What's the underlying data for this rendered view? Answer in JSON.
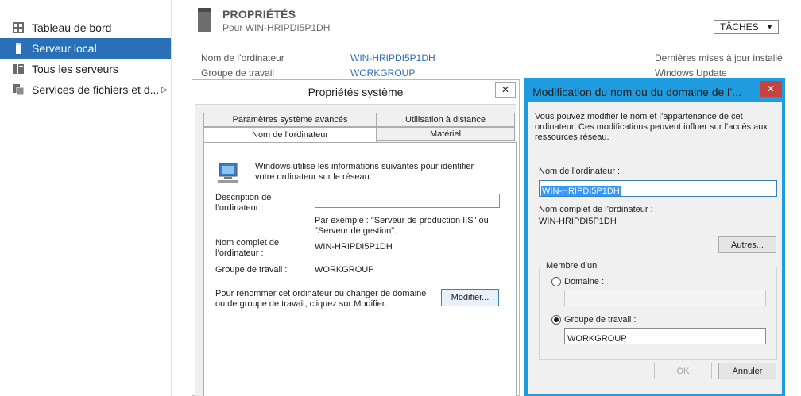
{
  "sidebar": {
    "items": [
      {
        "label": "Tableau de bord",
        "icon": "dashboard-icon",
        "active": false
      },
      {
        "label": "Serveur local",
        "icon": "server-icon",
        "active": true
      },
      {
        "label": "Tous les serveurs",
        "icon": "servers-icon",
        "active": false
      },
      {
        "label": "Services de fichiers et d...",
        "icon": "file-services-icon",
        "active": false
      }
    ]
  },
  "header": {
    "title": "PROPRIÉTÉS",
    "subtitle": "Pour WIN-HRIPDI5P1DH",
    "tasks_label": "TÂCHES"
  },
  "properties": {
    "computer_name_label": "Nom de l’ordinateur",
    "computer_name_value": "WIN-HRIPDI5P1DH",
    "workgroup_label": "Groupe de travail",
    "workgroup_value": "WORKGROUP",
    "last_updates_label": "Dernières mises à jour installé",
    "windows_update_label": "Windows Update"
  },
  "sysprops": {
    "title": "Propriétés système",
    "tabs_top": [
      "Paramètres système avancés",
      "Utilisation à distance"
    ],
    "tabs_bottom": [
      "Nom de l’ordinateur",
      "Matériel"
    ],
    "intro": "Windows utilise les informations suivantes pour identifier votre ordinateur sur le réseau.",
    "description_label": "Description de l’ordinateur :",
    "description_value": "",
    "example": "Par exemple : \"Serveur de production IIS\" ou \"Serveur de gestion\".",
    "fullname_label": "Nom complet de l’ordinateur :",
    "fullname_value": "WIN-HRIPDI5P1DH",
    "workgroup_label": "Groupe de travail :",
    "workgroup_value": "WORKGROUP",
    "rename_text": "Pour renommer cet ordinateur ou changer de domaine ou de groupe de travail, cliquez sur Modifier.",
    "modify_button": "Modifier..."
  },
  "rename": {
    "title": "Modification du nom ou du domaine de l’...",
    "intro": "Vous pouvez modifier le nom et l’appartenance de cet ordinateur. Ces modifications peuvent influer sur l’accès aux ressources réseau.",
    "name_label": "Nom de l’ordinateur :",
    "name_value": "WIN-HRIPDI5P1DH",
    "fullname_label": "Nom complet de l’ordinateur :",
    "fullname_value": "WIN-HRIPDI5P1DH",
    "more_button": "Autres...",
    "member_legend": "Membre d’un",
    "domain_label": "Domaine :",
    "domain_value": "",
    "workgroup_label": "Groupe de travail :",
    "workgroup_value": "WORKGROUP",
    "ok_button": "OK",
    "cancel_button": "Annuler"
  }
}
